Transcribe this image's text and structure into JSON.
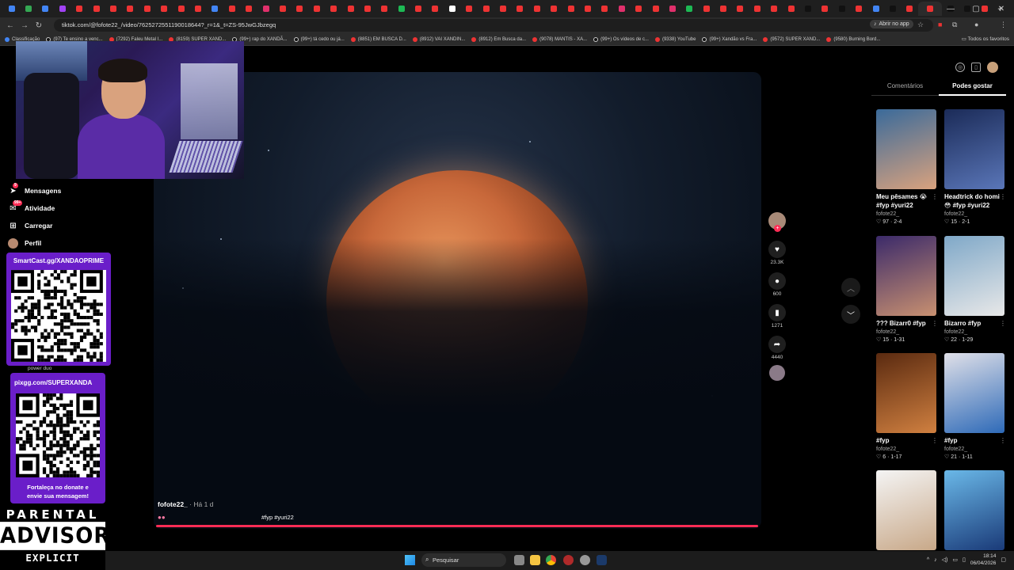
{
  "browser": {
    "url": "tiktok.com/@fofote22_/video/7625272551190018644?_r=1&_t=ZS-95JwGJbzegq",
    "open_in_app_label": "Abrir no app",
    "all_bookmarks_label": "Todos os favoritos",
    "bookmarks": [
      {
        "label": "Classificação",
        "kind": "site"
      },
      {
        "label": "(97) Te ensino a venc...",
        "kind": "tt"
      },
      {
        "label": "(7292) Faleu Metal I...",
        "kind": "yt"
      },
      {
        "label": "(8159) SUPER XAND...",
        "kind": "yt"
      },
      {
        "label": "(99+) rap do XANDÃ...",
        "kind": "tt"
      },
      {
        "label": "(99+) tá cedo ou já...",
        "kind": "tt"
      },
      {
        "label": "(8851) EM BUSCA D...",
        "kind": "yt"
      },
      {
        "label": "(8912) VAI XANDIN...",
        "kind": "yt"
      },
      {
        "label": "(8912) Em Busca da...",
        "kind": "yt"
      },
      {
        "label": "(9078) MANTIS - XA...",
        "kind": "yt"
      },
      {
        "label": "(99+) Os vídeos de c...",
        "kind": "tt"
      },
      {
        "label": "(9338) YouTube",
        "kind": "yt"
      },
      {
        "label": "(99+) Xandão vs Fra...",
        "kind": "tt"
      },
      {
        "label": "(9572) SUPER XAND...",
        "kind": "yt"
      },
      {
        "label": "(9580) Burning Bord...",
        "kind": "yt"
      }
    ],
    "tab_favicon_colors": [
      "#4285f4",
      "#34a853",
      "#4285f4",
      "#a142f4",
      "#e33",
      "#e33",
      "#e33",
      "#e33",
      "#e33",
      "#e33",
      "#e33",
      "#e33",
      "#4285f4",
      "#e33",
      "#e33",
      "#e1306c",
      "#e33",
      "#e33",
      "#e33",
      "#e33",
      "#e33",
      "#e33",
      "#e33",
      "#1db954",
      "#e33",
      "#e33",
      "#ffffff",
      "#e33",
      "#e33",
      "#e33",
      "#e33",
      "#e33",
      "#e33",
      "#e33",
      "#e33",
      "#e33",
      "#e1306c",
      "#e33",
      "#e33",
      "#e1306c",
      "#1db954",
      "#e33",
      "#e33",
      "#e33",
      "#e33",
      "#e33",
      "#e33",
      "#111111",
      "#e33",
      "#111111",
      "#e33",
      "#4285f4",
      "#111111",
      "#e33",
      "#e33",
      "#111111",
      "#111111",
      "#e33"
    ]
  },
  "sidebar": {
    "items": [
      {
        "label": "Mensagens",
        "icon": "send-icon",
        "badge": "9"
      },
      {
        "label": "Atividade",
        "icon": "activity-icon",
        "badge": "99+"
      },
      {
        "label": "Carregar",
        "icon": "upload-icon"
      },
      {
        "label": "Perfil",
        "icon": "profile-avatar"
      }
    ]
  },
  "overlays": {
    "qr1_title": "SmartCast.gg/XANDAOPRIME",
    "power_duo": "power duo",
    "qr2_title": "pixgg.com/SUPERXANDA",
    "qr2_message_1": "Fortaleça no donate e",
    "qr2_message_2": "envie sua mensagem!",
    "advisory_line1": "PARENTAL",
    "advisory_line2": "ADVISORY",
    "advisory_line3": "EXPLICIT CONTENT"
  },
  "video": {
    "author": "fofote22_",
    "ago": "· Há 1 d",
    "hashtags": "#fyp #yuri22",
    "emoji": "👄"
  },
  "actions": {
    "likes": "23.3K",
    "comments": "600",
    "saves": "1271",
    "shares": "4440"
  },
  "right_panel": {
    "tab_comments": "Comentários",
    "tab_suggested": "Podes gostar",
    "cards": [
      {
        "caption": "Meu pêsames 😭 #fyp #yuri22",
        "author": "fofote22_",
        "likes": "97",
        "ep": "2-4",
        "colors": [
          "#3a6a9a",
          "#d9a27e"
        ]
      },
      {
        "caption": "Headtrick do homi 😳 #fyp #yuri22",
        "author": "fofote22_",
        "likes": "15",
        "ep": "2-1",
        "colors": [
          "#1b2b58",
          "#5a76b8"
        ]
      },
      {
        "caption": "??? Bizarr0 #fyp",
        "author": "fofote22_",
        "likes": "15",
        "ep": "1-31",
        "colors": [
          "#3b2a6a",
          "#c89070"
        ]
      },
      {
        "caption": "Bizarro #fyp",
        "author": "fofote22_",
        "likes": "22",
        "ep": "1-29",
        "colors": [
          "#7fa8c8",
          "#e8e8e8"
        ]
      },
      {
        "caption": "#fyp",
        "author": "fofote22_",
        "likes": "6",
        "ep": "1-17",
        "colors": [
          "#5a2a10",
          "#d08040"
        ]
      },
      {
        "caption": "#fyp",
        "author": "fofote22_",
        "likes": "21",
        "ep": "1-11",
        "colors": [
          "#e0e0e8",
          "#2e6ab8"
        ]
      },
      {
        "caption": "",
        "author": "",
        "likes": "",
        "ep": "",
        "colors": [
          "#f4f4f4",
          "#c8a888"
        ]
      },
      {
        "caption": "",
        "author": "",
        "likes": "",
        "ep": "",
        "colors": [
          "#6ab8e8",
          "#1a3a78"
        ]
      }
    ]
  },
  "taskbar": {
    "search_label": "Pesquisar",
    "time": "18:14",
    "date": "06/04/2026"
  }
}
